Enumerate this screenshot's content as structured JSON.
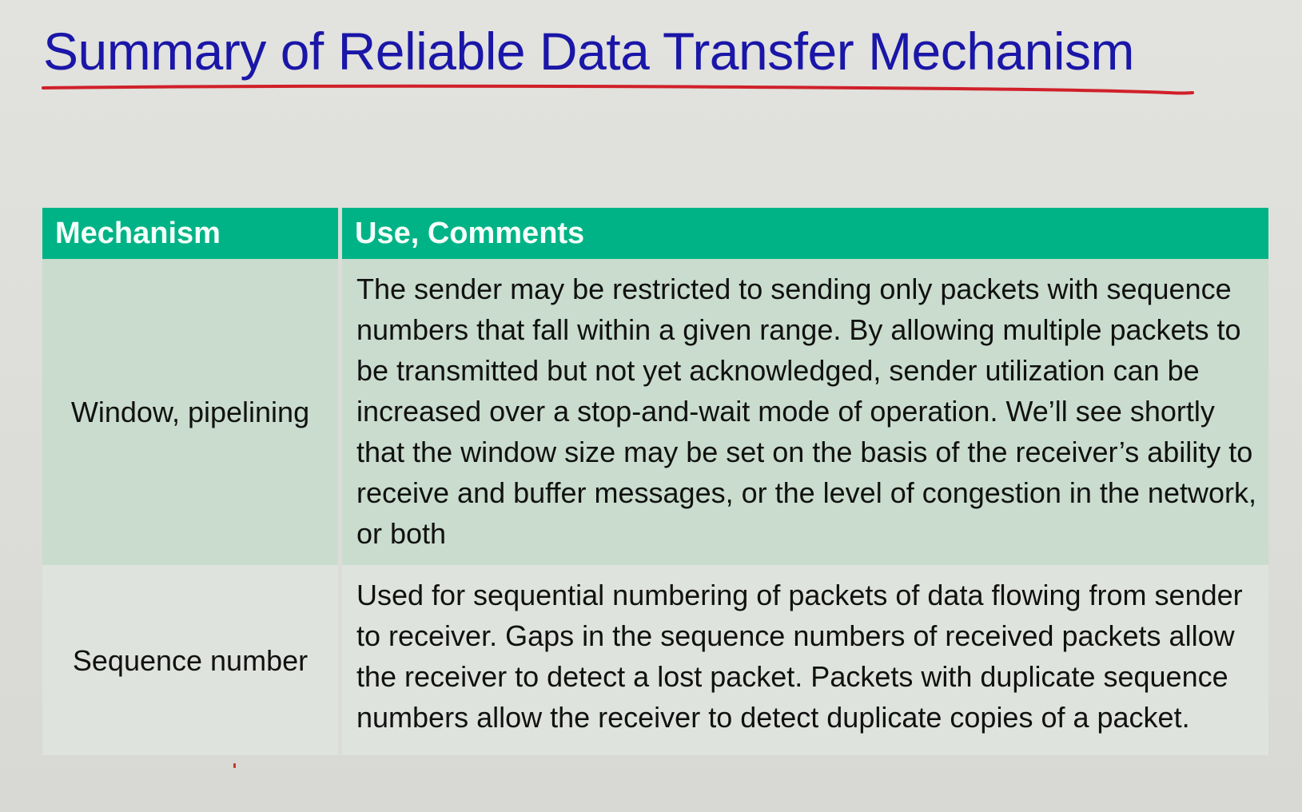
{
  "slide": {
    "title": "Summary of Reliable Data Transfer Mechanism",
    "title_color": "#1a16a8",
    "underline_color": "#d0202a",
    "header_color": "#00b386"
  },
  "table": {
    "headers": [
      "Mechanism",
      "Use, Comments"
    ],
    "rows": [
      {
        "mechanism": "Window, pipelining",
        "comments": "The sender may be restricted to sending only packets with sequence numbers that fall within a given range. By allowing multiple packets to be transmitted but not yet acknowledged, sender utilization can be increased over a stop-and-wait mode of operation. We’ll see shortly that the window size may be set on the basis of the receiver’s ability to receive and buffer messages, or the level of congestion in the network, or both"
      },
      {
        "mechanism": "Sequence number",
        "comments": "Used for sequential numbering of packets of data flowing from sender to receiver. Gaps in the sequence numbers of received packets allow the receiver to detect a lost packet. Packets with duplicate sequence numbers allow the receiver to detect duplicate copies of a packet."
      }
    ]
  }
}
